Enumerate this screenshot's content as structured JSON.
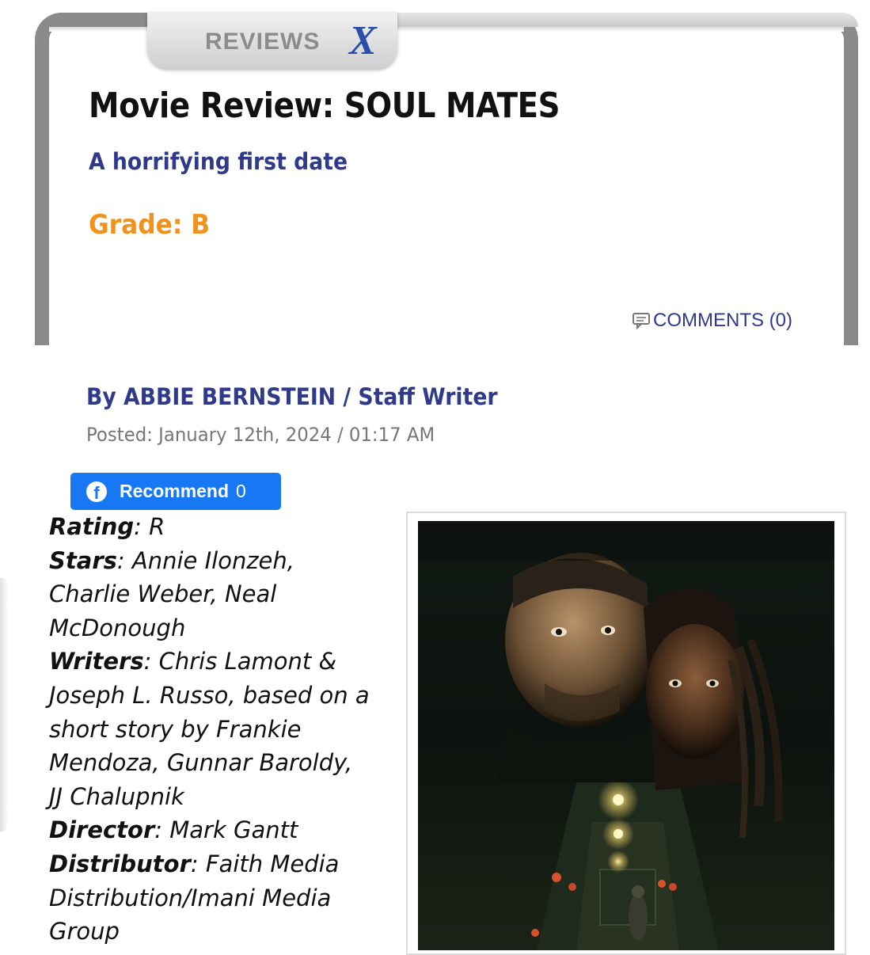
{
  "section": {
    "label": "REVIEWS",
    "logo_letter": "X"
  },
  "article": {
    "title": "Movie Review: SOUL MATES",
    "subtitle": "A horrifying first date",
    "grade": "Grade: B",
    "comments_link": "COMMENTS (0)",
    "byline": "By ABBIE BERNSTEIN / Staff Writer",
    "posted": "Posted: January 12th, 2024 / 01:17 AM"
  },
  "facebook": {
    "label": "Recommend",
    "count": "0"
  },
  "details": [
    {
      "key": "Rating",
      "lines": [
        "R"
      ]
    },
    {
      "key": "Stars",
      "lines": [
        "Annie Ilonzeh,",
        "Charlie Weber, Neal",
        "McDonough"
      ]
    },
    {
      "key": "Writers",
      "lines": [
        "Chris Lamont &",
        "Joseph L. Russo, based on a",
        "short story by Frankie",
        "Mendoza, Gunnar Baroldy,",
        "JJ Chalupnik"
      ]
    },
    {
      "key": "Director",
      "lines": [
        "Mark Gantt"
      ]
    },
    {
      "key": "Distributor",
      "lines": [
        "Faith Media",
        "Distribution/Imani Media",
        "Group"
      ]
    }
  ],
  "colors": {
    "link_blue": "#2f3a8a",
    "grade_orange": "#f0921c",
    "facebook_blue": "#1877f2",
    "frame_gray": "#8a8a8a"
  },
  "icons": {
    "comments": "speech-bubble-icon",
    "facebook": "facebook-icon",
    "logo": "x-logo-icon"
  }
}
